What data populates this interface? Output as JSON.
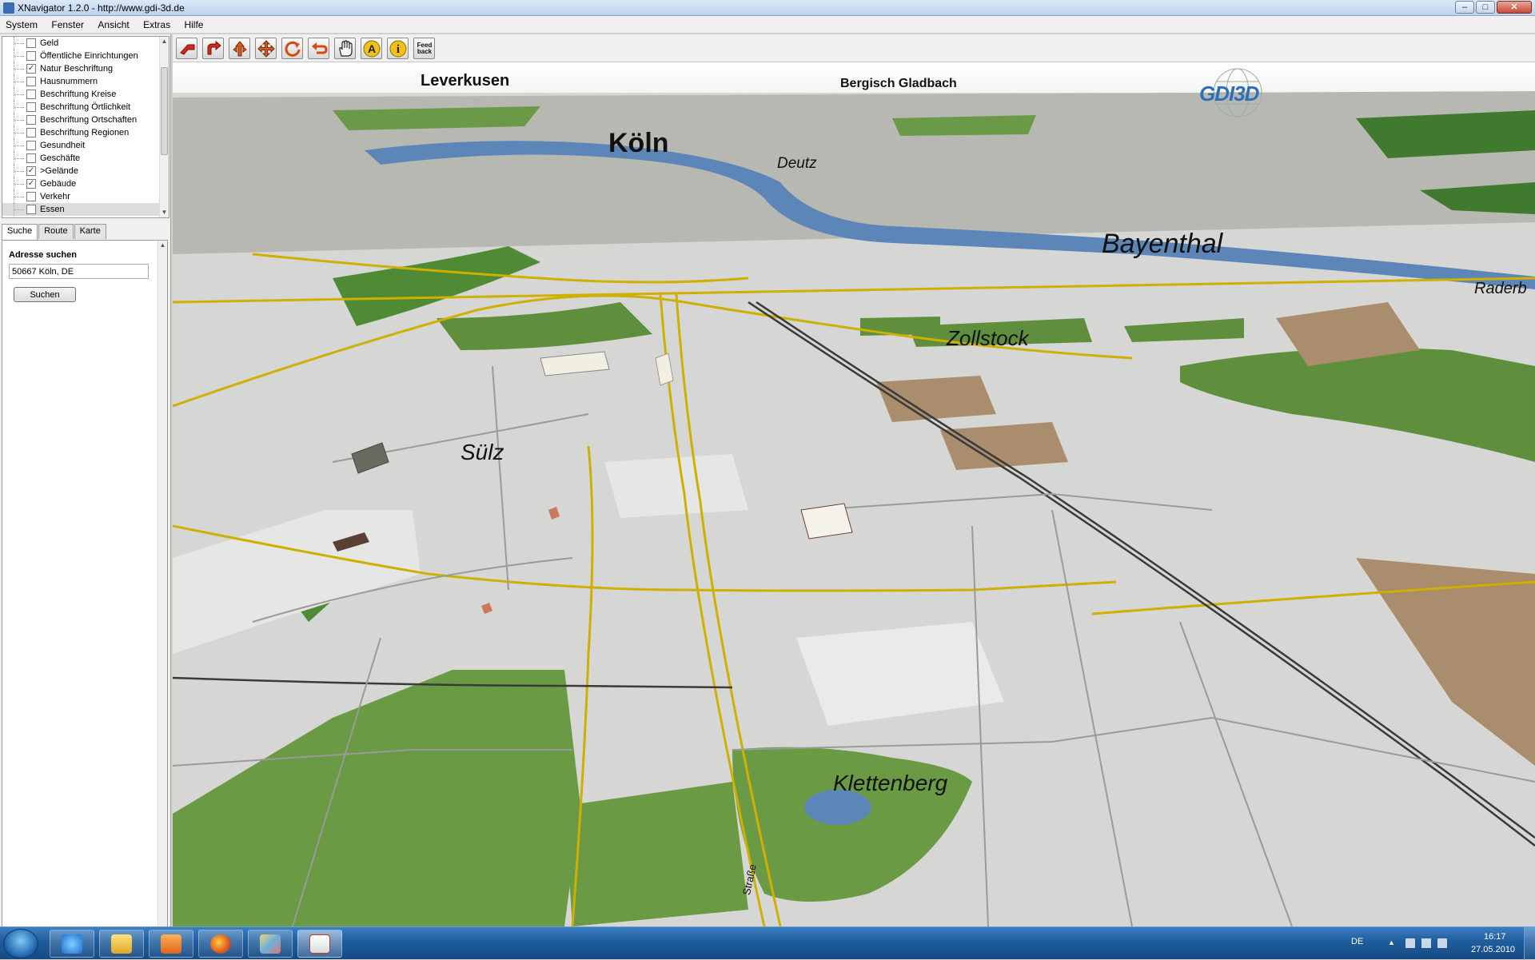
{
  "window": {
    "title": "XNavigator 1.2.0 - http://www.gdi-3d.de"
  },
  "menu": [
    "System",
    "Fenster",
    "Ansicht",
    "Extras",
    "Hilfe"
  ],
  "layers": [
    {
      "label": "Geld",
      "checked": false
    },
    {
      "label": "Öffentliche Einrichtungen",
      "checked": false
    },
    {
      "label": "Natur Beschriftung",
      "checked": true
    },
    {
      "label": "Hausnummern",
      "checked": false
    },
    {
      "label": "Beschriftung Kreise",
      "checked": false
    },
    {
      "label": "Beschriftung Örtlichkeit",
      "checked": false
    },
    {
      "label": "Beschriftung Ortschaften",
      "checked": false
    },
    {
      "label": "Beschriftung Regionen",
      "checked": false
    },
    {
      "label": "Gesundheit",
      "checked": false
    },
    {
      "label": "Geschäfte",
      "checked": false
    },
    {
      "label": ">Gelände",
      "checked": true
    },
    {
      "label": "Gebäude",
      "checked": true
    },
    {
      "label": "Verkehr",
      "checked": false
    },
    {
      "label": "Essen",
      "checked": false,
      "selected": true
    }
  ],
  "tabs": [
    "Suche",
    "Route",
    "Karte"
  ],
  "search": {
    "heading": "Adresse suchen",
    "address_value": "50667 Köln, DE",
    "button_label": "Suchen"
  },
  "toolbar": {
    "tools": [
      "rotate-left-icon",
      "turn-icon",
      "move-up-icon",
      "pan-icon",
      "refresh-icon",
      "return-icon",
      "hand-icon",
      "label-icon",
      "info-icon",
      "feedback-icon"
    ],
    "feedback_label_1": "Feed",
    "feedback_label_2": "back",
    "label_tool": "A",
    "info_tool": "i"
  },
  "map": {
    "logo": "GDI3D",
    "places": {
      "leverkusen": "Leverkusen",
      "bergisch_gladbach": "Bergisch Gladbach",
      "koeln": "Köln",
      "deutz": "Deutz",
      "bayenthal": "Bayenthal",
      "raderberg": "Raderb",
      "zollstock": "Zollstock",
      "suelz": "Sülz",
      "klettenberg": "Klettenberg",
      "strasse": "Straße"
    },
    "colors": {
      "ground": "#d8d8d6",
      "green": "#5f8f3c",
      "water": "#5d86b8",
      "road": "#cfb000",
      "rail": "#3a3a3a"
    }
  },
  "taskbar": {
    "apps": [
      "internet-explorer-icon",
      "explorer-icon",
      "media-player-icon",
      "firefox-icon",
      "paint-icon",
      "java-icon"
    ],
    "language": "DE",
    "time": "16:17",
    "date": "27.05.2010"
  }
}
